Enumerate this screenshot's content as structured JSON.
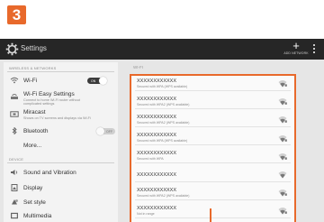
{
  "step_badge": "3",
  "actionbar": {
    "title": "Settings",
    "add_network_label": "ADD NETWORK",
    "icons": [
      "gear-icon",
      "plus-icon",
      "overflow-menu-icon"
    ]
  },
  "sidebar": {
    "wireless_header": "WIRELESS & NETWORKS",
    "device_header": "DEVICE",
    "items": [
      {
        "label": "Wi-Fi",
        "icon": "wifi-icon",
        "toggle": "ON"
      },
      {
        "label": "Wi-Fi Easy Settings",
        "sublabel": "Connect to home Wi-Fi router without complicated settings",
        "icon": "wifi-easy-icon"
      },
      {
        "label": "Miracast",
        "sublabel": "Shows on TV screens and displays via Wi-Fi",
        "icon": "miracast-icon"
      },
      {
        "label": "Bluetooth",
        "icon": "bluetooth-icon",
        "toggle": "OFF"
      },
      {
        "label": "More...",
        "icon": ""
      },
      {
        "label": "Sound and Vibration",
        "icon": "speaker-icon"
      },
      {
        "label": "Display",
        "icon": "display-icon"
      },
      {
        "label": "Set style",
        "icon": "style-icon"
      },
      {
        "label": "Multimedia",
        "icon": "multimedia-icon"
      }
    ]
  },
  "content": {
    "header": "WI-FI",
    "networks": [
      {
        "ssid": "XXXXXXXXXXXX",
        "security": "Secured with WPA (WPS available)"
      },
      {
        "ssid": "XXXXXXXXXXXX",
        "security": "Secured with WPA2 (WPS available)"
      },
      {
        "ssid": "XXXXXXXXXXXX",
        "security": "Secured with WPA2 (WPS available)"
      },
      {
        "ssid": "XXXXXXXXXXXX",
        "security": "Secured with WPA (WPS available)"
      },
      {
        "ssid": "XXXXXXXXXXXX",
        "security": "Secured with WPA"
      },
      {
        "ssid": "XXXXXXXXXXXX",
        "security": ""
      },
      {
        "ssid": "XXXXXXXXXXXX",
        "security": "Secured with WPA2 (WPS available)"
      },
      {
        "ssid": "XXXXXXXXXXXX",
        "security": "Not in range"
      }
    ]
  },
  "colors": {
    "accent": "#e8692b",
    "actionbar": "#262626"
  }
}
